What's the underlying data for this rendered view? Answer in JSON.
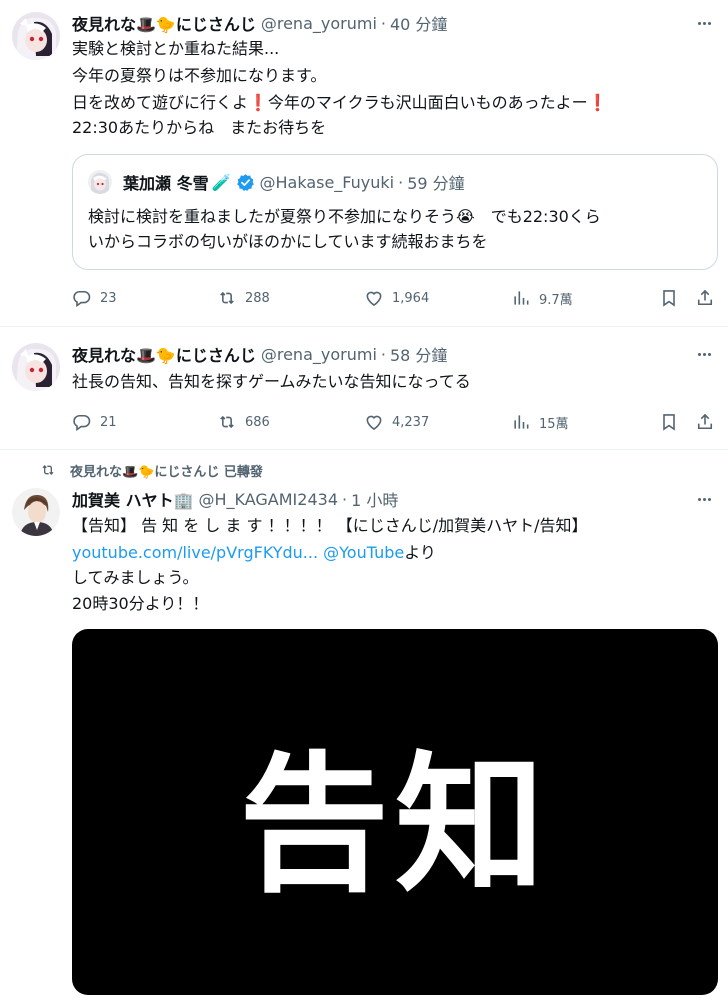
{
  "tweets": [
    {
      "name": "夜見れな🎩🐤にじさんじ",
      "handle": "@rena_yorumi",
      "time": "40 分鐘",
      "lines": [
        "実験と検討とか重ねた結果...",
        "今年の夏祭りは不参加になります。",
        "日を改めて遊びに行くよ❗今年のマイクラも沢山面白いものあったよー❗",
        "22:30あたりからね　またお待ちを"
      ],
      "quote": {
        "name": "葉加瀬 冬雪",
        "name_emoji": "🧪",
        "handle": "@Hakase_Fuyuki",
        "time": "59 分鐘",
        "line1": "検討に検討を重ねましたが夏祭り不参加になりそう😭　でも22:30くら",
        "line2": "いからコラボの匂いがほのかにしています続報おまちを"
      },
      "stats": {
        "replies": "23",
        "retweets": "288",
        "likes": "1,964",
        "views": "9.7萬"
      }
    },
    {
      "name": "夜見れな🎩🐤にじさんじ",
      "handle": "@rena_yorumi",
      "time": "58 分鐘",
      "lines": [
        "社長の告知、告知を探すゲームみたいな告知になってる"
      ],
      "stats": {
        "replies": "21",
        "retweets": "686",
        "likes": "4,237",
        "views": "15萬"
      }
    },
    {
      "retweeted_by": "夜見れな🎩🐤にじさんじ 已轉發",
      "name": "加賀美 ハヤト🏢",
      "handle": "@H_KAGAMI2434",
      "time": "1 小時",
      "line1": "【告知】 告 知 を し ま す ！！！！ 【にじさんじ/加賀美ハヤト/告知】",
      "link": "youtube.com/live/pVrgFKYdu...",
      "link2": "@YouTube",
      "link_suffix": "より",
      "line3": "してみましょう。",
      "line4": "20時30分より！！",
      "media_text": "告知"
    }
  ],
  "icons": {
    "reply": "reply-icon",
    "retweet": "retweet-icon",
    "like": "heart-icon",
    "views": "views-icon",
    "bookmark": "bookmark-icon",
    "share": "share-icon",
    "more": "more-icon",
    "verified": "verified-icon"
  },
  "colors": {
    "link": "#1d9bf0",
    "secondary": "#536471",
    "verified": "#1d9bf0"
  }
}
